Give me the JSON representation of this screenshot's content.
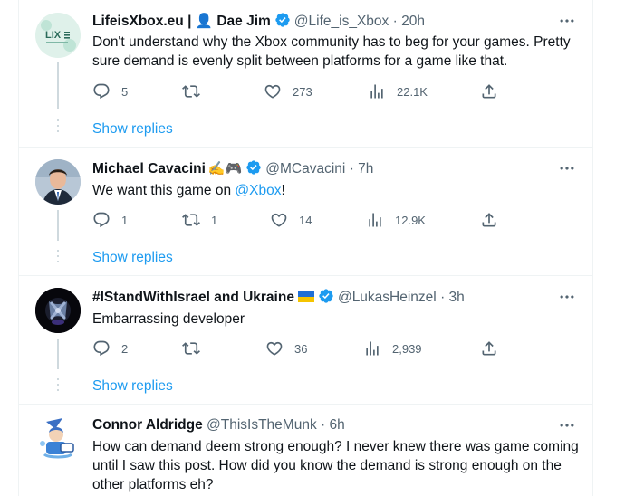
{
  "tweets": [
    {
      "name": "LifeisXbox.eu | 👤 Dae Jim",
      "handle": "@Life_is_Xbox",
      "time": "20h",
      "text": "Don't understand why the Xbox community has to beg for your games. Pretty sure demand is evenly split between platforms for a game like that.",
      "avatar_text": "LIX",
      "replies": "5",
      "retweets": "",
      "likes": "273",
      "views": "22.1K",
      "show_replies": "Show replies"
    },
    {
      "name": "Michael Cavacini",
      "name_emoji": "✍️🎮",
      "handle": "@MCavacini",
      "time": "7h",
      "text_prefix": "We want this game on ",
      "mention": "@Xbox",
      "text_suffix": "!",
      "replies": "1",
      "retweets": "1",
      "likes": "14",
      "views": "12.9K",
      "show_replies": "Show replies"
    },
    {
      "name": "#IStandWithIsrael and Ukraine",
      "handle": "@LukasHeinzel",
      "time": "3h",
      "text": "Embarrassing developer",
      "replies": "2",
      "retweets": "",
      "likes": "36",
      "views": "2,939",
      "show_replies": "Show replies"
    },
    {
      "name": "Connor Aldridge",
      "handle": "@ThisIsTheMunk",
      "time": "6h",
      "text": "How can demand deem strong enough? I never knew there was game coming until I saw this post. How did you know the demand is strong enough on the other platforms eh?"
    }
  ],
  "ui": {
    "midot": "·"
  },
  "colors": {
    "accent": "#1d9bf0",
    "muted": "#536471",
    "border": "#eff3f4",
    "thread": "#cfd9de"
  },
  "icons": [
    "reply-icon",
    "retweet-icon",
    "like-icon",
    "views-icon",
    "share-icon",
    "more-icon",
    "verified-icon"
  ]
}
